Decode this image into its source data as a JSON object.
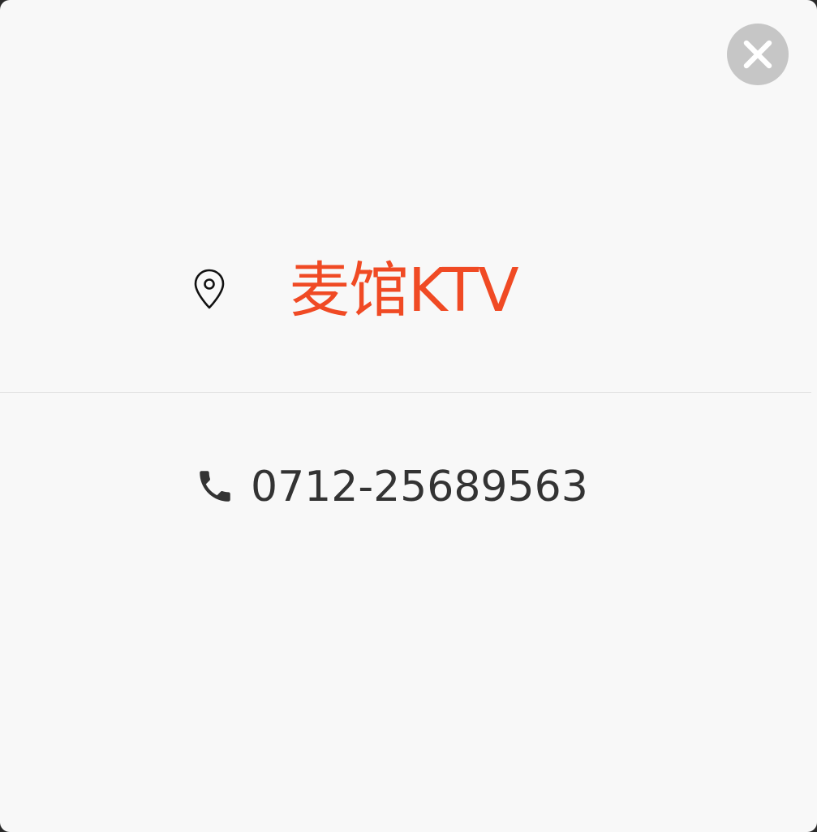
{
  "venue": {
    "name": "麦馆KTV",
    "pin_icon": "map-pin-icon"
  },
  "contact": {
    "phone": "0712-25689563",
    "phone_icon": "phone-icon"
  },
  "close_icon": "close-icon",
  "colors": {
    "background": "#f8f8f8",
    "accent": "#f04a24",
    "text": "#333333",
    "close_button": "#c6c6c6",
    "divider": "#e4e4e4"
  }
}
